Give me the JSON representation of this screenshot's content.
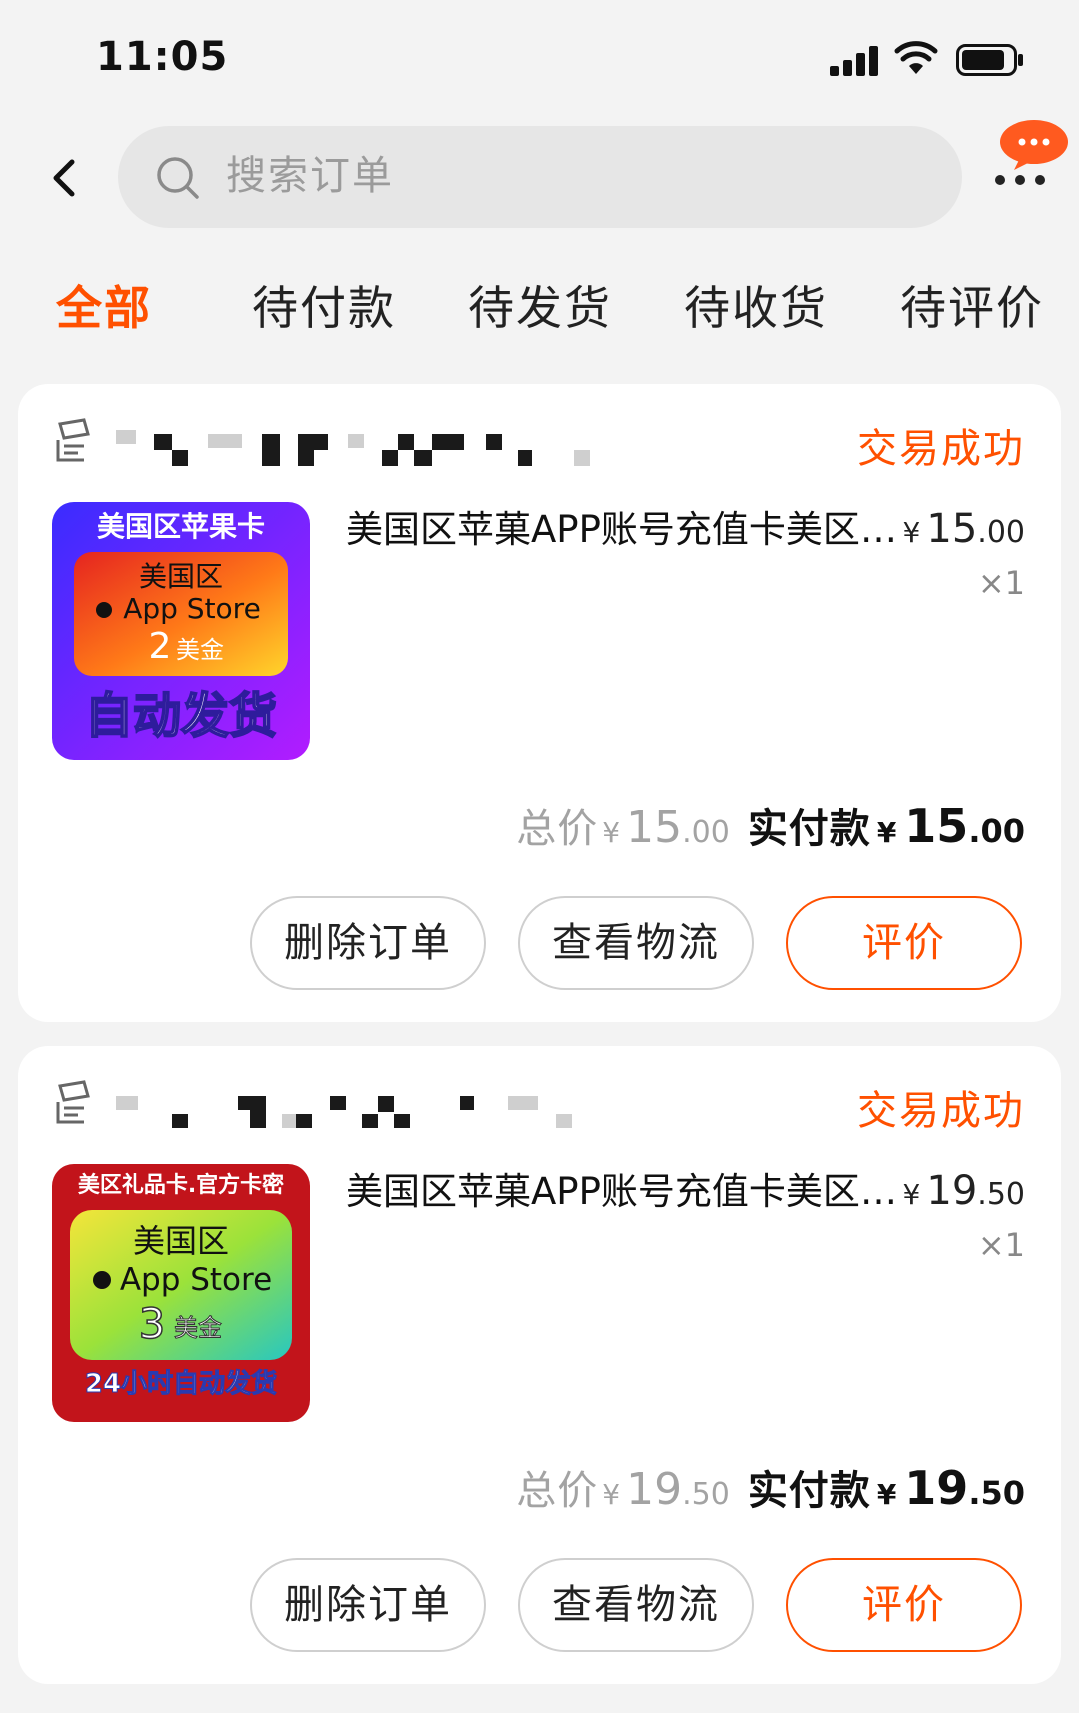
{
  "status_bar": {
    "time": "11:05"
  },
  "header": {
    "search_placeholder": "搜索订单"
  },
  "tabs": [
    {
      "label": "全部",
      "active": true
    },
    {
      "label": "待付款",
      "active": false
    },
    {
      "label": "待发货",
      "active": false
    },
    {
      "label": "待收货",
      "active": false
    },
    {
      "label": "待评价",
      "active": false
    }
  ],
  "colors": {
    "accent": "#ff5000",
    "background": "#f3f3f3"
  },
  "orders": [
    {
      "status": "交易成功",
      "thumb": {
        "top": "美国区苹果卡",
        "region": "美国区",
        "store": "App Store",
        "amount": "2",
        "unit": "美金",
        "bottom": "自动发货"
      },
      "title": "美国区苹菓APP账号充值卡美区礼品卡",
      "price_currency": "¥",
      "price_int": "15",
      "price_dec": ".00",
      "qty": "×1",
      "total_label": "总价",
      "total_currency": "¥",
      "total_int": "15",
      "total_dec": ".00",
      "paid_label": "实付款",
      "paid_currency": "¥",
      "paid_int": "15",
      "paid_dec": ".00",
      "buttons": {
        "delete": "删除订单",
        "logistics": "查看物流",
        "review": "评价"
      }
    },
    {
      "status": "交易成功",
      "thumb": {
        "top": "美区礼品卡.官方卡密",
        "region": "美国区",
        "store": "App Store",
        "amount": "3",
        "unit": "美金",
        "bottom": "24小时自动发货"
      },
      "title": "美国区苹菓APP账号充值卡美区礼品卡",
      "price_currency": "¥",
      "price_int": "19",
      "price_dec": ".50",
      "qty": "×1",
      "total_label": "总价",
      "total_currency": "¥",
      "total_int": "19",
      "total_dec": ".50",
      "paid_label": "实付款",
      "paid_currency": "¥",
      "paid_int": "19",
      "paid_dec": ".50",
      "buttons": {
        "delete": "删除订单",
        "logistics": "查看物流",
        "review": "评价"
      }
    }
  ]
}
